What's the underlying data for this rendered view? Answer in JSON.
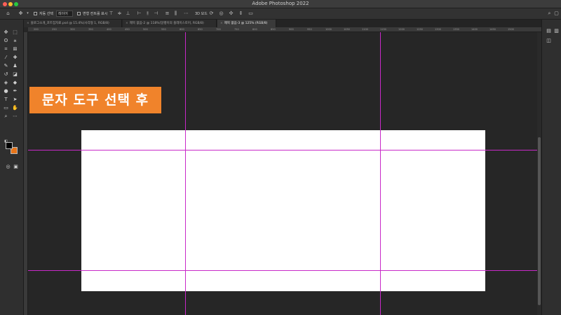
{
  "window": {
    "title": "Adobe Photoshop 2022"
  },
  "options_bar": {
    "auto_select_label": "자동 선택",
    "auto_select_target": "레이어",
    "show_transform_label": "변형 컨트롤 표시",
    "mode_3d_label": "3D 모드"
  },
  "tabs": [
    {
      "label": "블로그소개_포트집자료.psd @ 15.4%(사각형 1, RGB/8)"
    },
    {
      "label": "제목 없음-2 @ 118%(달팽이의 플레이스토어, RGB/8)"
    },
    {
      "label": "제목 없음-3 @ 125% (RGB/8)"
    }
  ],
  "ruler": {
    "ticks": [
      "200",
      "250",
      "300",
      "350",
      "400",
      "450",
      "500",
      "550",
      "600",
      "650",
      "700",
      "750",
      "800",
      "850",
      "900",
      "950",
      "1000",
      "1050",
      "1100",
      "1150",
      "1200",
      "1250",
      "1300",
      "1350",
      "1400",
      "1450",
      "1500"
    ]
  },
  "caption": {
    "text": "문자 도구 선택 후"
  },
  "colors": {
    "foreground": "#000000",
    "background": "#e8751a",
    "guide": "#c829c8",
    "caption_bg": "#f0832b"
  }
}
